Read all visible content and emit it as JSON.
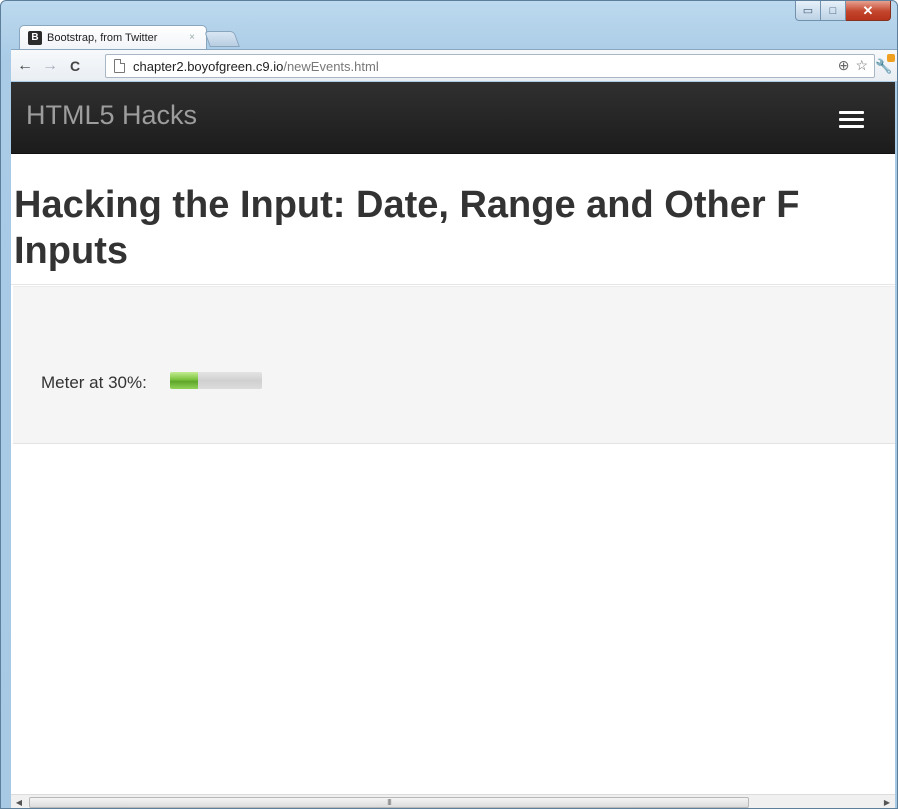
{
  "browser": {
    "tab": {
      "favicon_letter": "B",
      "title": "Bootstrap, from Twitter",
      "close_glyph": "×"
    },
    "window_controls": {
      "minimize": "▭",
      "maximize": "□",
      "close": "✕"
    },
    "nav": {
      "back": "←",
      "forward": "→",
      "reload": "C"
    },
    "address_bar": {
      "host": "chapter2.boyofgreen.c9.io",
      "path": "/newEvents.html"
    },
    "icons": {
      "zoom": "zoom-icon",
      "star": "star-icon",
      "wrench": "wrench-icon"
    }
  },
  "page": {
    "navbar": {
      "brand": "HTML5 Hacks",
      "bg_color": "#222222"
    },
    "title_line1": "Hacking the Input: Date, Range and Other F",
    "title_line2": "Inputs",
    "meter": {
      "label": "Meter at 30%:",
      "value": 0.3,
      "fill_color": "#7bc33d"
    }
  },
  "scrollbar": {
    "grip": "III"
  }
}
